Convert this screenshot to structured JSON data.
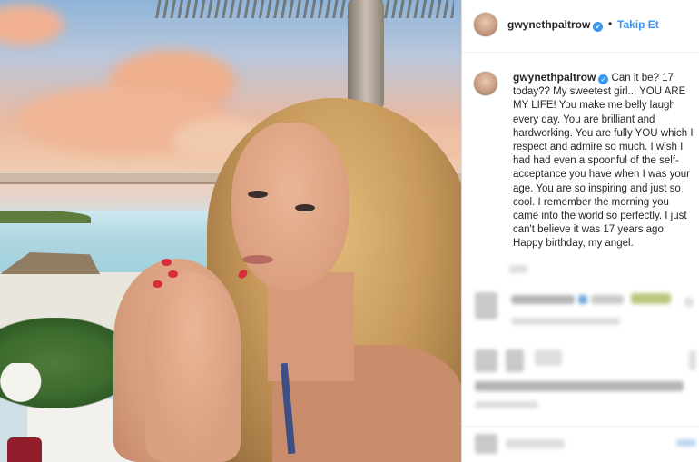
{
  "post_header": {
    "username": "gwynethpaltrow",
    "verified_icon": "verified-badge-icon",
    "separator": "•",
    "follow_label": "Takip Et"
  },
  "caption": {
    "username": "gwynethpaltrow",
    "text": "Can it be? 17 today?? My sweetest girl... YOU ARE MY LIFE! You make me belly laugh every day. You are brilliant and hardworking. You are fully YOU which I respect and admire so much. I wish I had had even a spoonful of the self-acceptance you have when I was your age. You are so inspiring and just so cool. I remember the morning you came into the world so perfectly. I just can't believe it was 17 years ago. Happy birthday, my angel."
  },
  "colors": {
    "accent": "#3897f0",
    "text": "#262626",
    "border": "#dbdbdb"
  }
}
